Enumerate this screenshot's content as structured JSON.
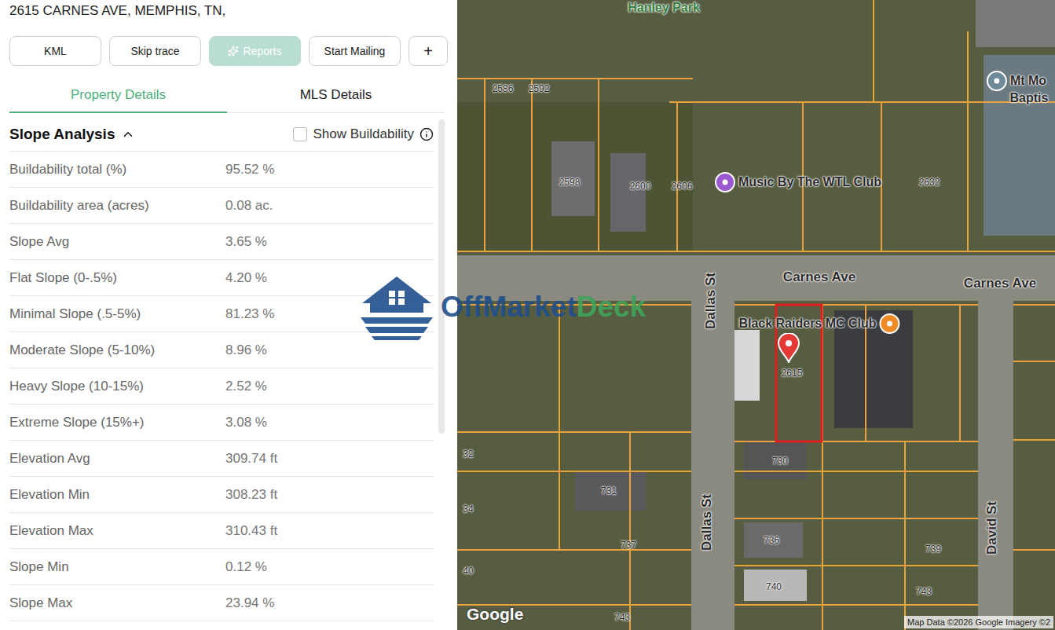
{
  "header": {
    "address": "2615 CARNES AVE, MEMPHIS, TN,"
  },
  "toolbar": [
    {
      "label": "KML",
      "disabled": false,
      "kind": "text"
    },
    {
      "label": "Skip trace",
      "disabled": false,
      "kind": "text"
    },
    {
      "label": "Reports",
      "disabled": true,
      "kind": "sparkle"
    },
    {
      "label": "Start Mailing",
      "disabled": false,
      "kind": "text"
    },
    {
      "label": "+",
      "disabled": false,
      "kind": "text"
    }
  ],
  "tabs": [
    {
      "label": "Property Details",
      "selected": true
    },
    {
      "label": "MLS Details",
      "selected": false
    }
  ],
  "section": {
    "title": "Slope Analysis",
    "expanded": true,
    "toggle": {
      "label": "Show Buildability",
      "checked": false
    }
  },
  "rows": [
    {
      "label": "Buildability total (%)",
      "value": "95.52 %"
    },
    {
      "label": "Buildability area (acres)",
      "value": "0.08 ac."
    },
    {
      "label": "Slope Avg",
      "value": "3.65 %"
    },
    {
      "label": "Flat Slope (0-.5%)",
      "value": "4.20 %"
    },
    {
      "label": "Minimal Slope (.5-5%)",
      "value": "81.23 %"
    },
    {
      "label": "Moderate Slope (5-10%)",
      "value": "8.96 %"
    },
    {
      "label": "Heavy Slope (10-15%)",
      "value": "2.52 %"
    },
    {
      "label": "Extreme Slope (15%+)",
      "value": "3.08 %"
    },
    {
      "label": "Elevation Avg",
      "value": "309.74 ft"
    },
    {
      "label": "Elevation Min",
      "value": "308.23 ft"
    },
    {
      "label": "Elevation Max",
      "value": "310.43 ft"
    },
    {
      "label": "Slope Min",
      "value": "0.12 %"
    },
    {
      "label": "Slope Max",
      "value": "23.94 %"
    }
  ],
  "map": {
    "labels": [
      {
        "text": "Hanley Park",
        "kind": "park"
      },
      {
        "text": "2586",
        "kind": "parcel"
      },
      {
        "text": "2592",
        "kind": "parcel"
      },
      {
        "text": "2598",
        "kind": "parcel"
      },
      {
        "text": "2600",
        "kind": "parcel"
      },
      {
        "text": "2606",
        "kind": "parcel"
      },
      {
        "text": "2632",
        "kind": "parcel"
      },
      {
        "text": "2615",
        "kind": "parcel"
      },
      {
        "text": "730",
        "kind": "parcel"
      },
      {
        "text": "731",
        "kind": "parcel"
      },
      {
        "text": "737",
        "kind": "parcel"
      },
      {
        "text": "736",
        "kind": "parcel"
      },
      {
        "text": "739",
        "kind": "parcel"
      },
      {
        "text": "740",
        "kind": "parcel"
      },
      {
        "text": "743",
        "kind": "parcel"
      },
      {
        "text": "743",
        "kind": "parcel"
      },
      {
        "text": "32",
        "kind": "parcel"
      },
      {
        "text": "34",
        "kind": "parcel"
      },
      {
        "text": "40",
        "kind": "parcel"
      },
      {
        "text": "Carnes Ave",
        "kind": "street"
      },
      {
        "text": "Carnes Ave",
        "kind": "street"
      },
      {
        "text": "Dallas St",
        "kind": "vstreet"
      },
      {
        "text": "Dallas St",
        "kind": "vstreet"
      },
      {
        "text": "David St",
        "kind": "vstreet"
      },
      {
        "text": "Music By The WTL Club",
        "kind": "poi-left",
        "color": "#9b59d0"
      },
      {
        "text": "Black Raiders MC Club",
        "kind": "poi-right",
        "color": "#f08a24"
      },
      {
        "text": "Mt Mo",
        "kind": "poi-left",
        "color": "#6f8a99"
      },
      {
        "text": "Baptis",
        "kind": "poi-text"
      }
    ],
    "logo": "Google",
    "attribution": "Map Data ©2026 Google Imagery ©2"
  },
  "watermark": {
    "parts": [
      {
        "text": "OffMarket",
        "color": "#1f4f8c"
      },
      {
        "text": "Deck",
        "color": "#3fa45b"
      }
    ]
  }
}
